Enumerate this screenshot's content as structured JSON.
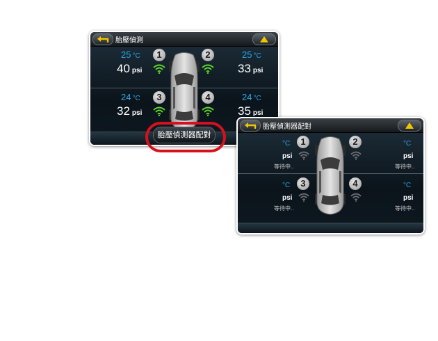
{
  "screen1": {
    "title": "胎壓偵測",
    "tires": [
      {
        "id": "1",
        "temp": "25",
        "temp_unit": "°C",
        "pressure": "40",
        "pressure_unit": "psi"
      },
      {
        "id": "2",
        "temp": "25",
        "temp_unit": "°C",
        "pressure": "33",
        "pressure_unit": "psi"
      },
      {
        "id": "3",
        "temp": "24",
        "temp_unit": "°C",
        "pressure": "32",
        "pressure_unit": "psi"
      },
      {
        "id": "4",
        "temp": "24",
        "temp_unit": "°C",
        "pressure": "35",
        "pressure_unit": "psi"
      }
    ],
    "pair_button_label": "胎壓偵測器配對",
    "signal_color": "#5fd62a"
  },
  "screen2": {
    "title": "胎壓偵測器配對",
    "tires": [
      {
        "id": "1",
        "temp_unit": "°C",
        "pressure_unit": "psi",
        "status": "等待中.."
      },
      {
        "id": "2",
        "temp_unit": "°C",
        "pressure_unit": "psi",
        "status": "等待中.."
      },
      {
        "id": "3",
        "temp_unit": "°C",
        "pressure_unit": "psi",
        "status": "等待中.."
      },
      {
        "id": "4",
        "temp_unit": "°C",
        "pressure_unit": "psi",
        "status": "等待中.."
      }
    ],
    "signal_color": "#6f6f6f"
  },
  "icons": {
    "back": "back-arrow-icon",
    "up": "up-triangle-icon",
    "signal": "wifi-signal-icon",
    "car": "car-top-view-icon"
  },
  "colors": {
    "accent_yellow": "#f3c400",
    "temp_blue": "#2aa7e8",
    "callout_red": "#d8101e"
  }
}
